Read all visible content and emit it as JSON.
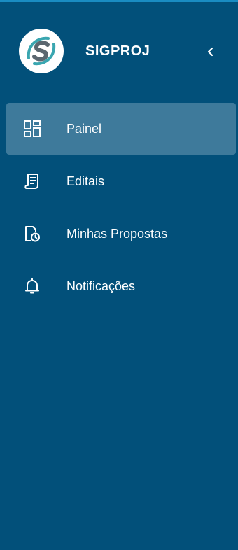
{
  "app": {
    "title": "SIGPROJ"
  },
  "colors": {
    "sidebar_bg": "#02507a",
    "active_item_bg": "#3e7a9b",
    "top_border": "#1a8cc2",
    "text": "#ffffff"
  },
  "header": {
    "collapse_icon": "chevron-left-icon"
  },
  "nav": {
    "items": [
      {
        "label": "Painel",
        "icon": "dashboard-icon",
        "active": true
      },
      {
        "label": "Editais",
        "icon": "document-list-icon",
        "active": false
      },
      {
        "label": "Minhas Propostas",
        "icon": "file-clock-icon",
        "active": false
      },
      {
        "label": "Notificações",
        "icon": "bell-icon",
        "active": false
      }
    ]
  }
}
